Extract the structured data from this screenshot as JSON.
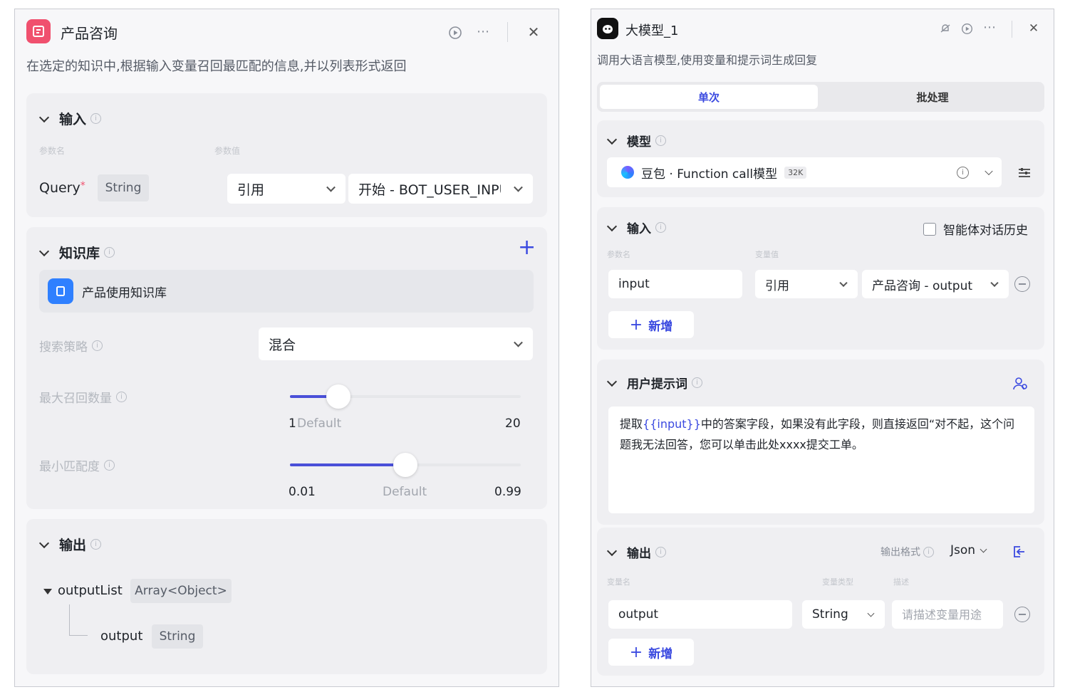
{
  "left": {
    "title": "产品咨询",
    "description": "在选定的知识中,根据输入变量召回最匹配的信息,并以列表形式返回",
    "input_section": {
      "title": "输入",
      "col_param_name": "参数名",
      "col_param_value": "参数值",
      "param_name": "Query",
      "required_mark": "*",
      "param_type": "String",
      "value_mode": "引用",
      "value_source": "开始 - BOT_USER_INPUT"
    },
    "knowledge_section": {
      "title": "知识库",
      "add_symbol": "+",
      "kb_item": "产品使用知识库",
      "strategy_label": "搜索策略",
      "strategy_value": "混合",
      "max_recall_label": "最大召回数量",
      "max_recall_min": "1",
      "max_recall_default": "Default",
      "max_recall_max": "20",
      "max_recall_value": 5,
      "min_match_label": "最小匹配度",
      "min_match_min": "0.01",
      "min_match_default": "Default",
      "min_match_max": "0.99",
      "min_match_value": 0.5
    },
    "output_section": {
      "title": "输出",
      "list_name": "outputList",
      "list_type": "Array<Object>",
      "child_name": "output",
      "child_type": "String"
    }
  },
  "right": {
    "title": "大模型_1",
    "description": "调用大语言模型,使用变量和提示词生成回复",
    "tab_single": "单次",
    "tab_batch": "批处理",
    "model_section": {
      "title": "模型",
      "model_name": "豆包 · Function call模型",
      "model_badge": "32K"
    },
    "input_section": {
      "title": "输入",
      "history_label": "智能体对话历史",
      "col_param_name": "参数名",
      "col_var_value": "变量值",
      "param_name": "input",
      "value_mode": "引用",
      "value_source": "产品咨询 - output",
      "add_label": "新增"
    },
    "prompt_section": {
      "title": "用户提示词",
      "text_before": "提取",
      "text_var": "{{input}}",
      "text_after": "中的答案字段，如果没有此字段，则直接返回“对不起，这个问题我无法回答，您可以单击此处xxxx提交工单。"
    },
    "output_section": {
      "title": "输出",
      "format_label": "输出格式",
      "format_value": "Json",
      "col_var_name": "变量名",
      "col_var_type": "变量类型",
      "col_desc": "描述",
      "var_name": "output",
      "var_type": "String",
      "desc_placeholder": "请描述变量用途",
      "add_label": "新增"
    }
  },
  "colors": {
    "accent": "#3b4ae0",
    "slider": "#4a4fd8",
    "node_icon_left": "#f0506e",
    "kb_icon": "#2f80ff"
  },
  "icons": [
    "document-icon",
    "play-icon",
    "more-icon",
    "close-icon",
    "bot-icon",
    "bell-off-icon",
    "settings-icon",
    "plus-icon",
    "minus-circle-icon",
    "info-icon",
    "user-icon",
    "export-icon"
  ]
}
